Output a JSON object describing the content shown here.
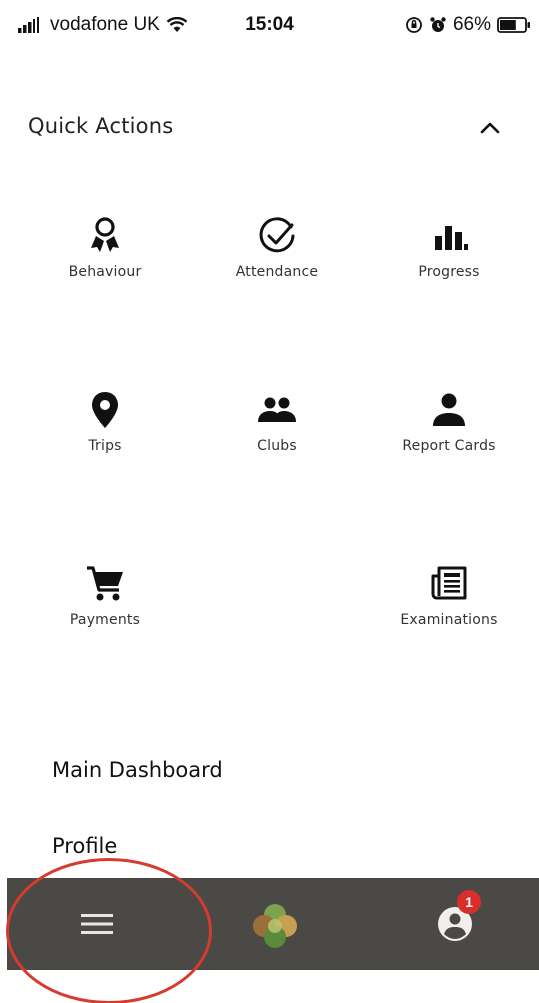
{
  "status_bar": {
    "carrier": "vodafone UK",
    "time": "15:04",
    "battery": "66%",
    "battery_level": 0.66
  },
  "quick_actions": {
    "title": "Quick Actions",
    "items": [
      {
        "label": "Behaviour",
        "icon": "award-ribbon-icon"
      },
      {
        "label": "Attendance",
        "icon": "check-circle-icon"
      },
      {
        "label": "Progress",
        "icon": "bar-chart-icon"
      },
      {
        "label": "Trips",
        "icon": "map-pin-icon"
      },
      {
        "label": "Clubs",
        "icon": "people-icon"
      },
      {
        "label": "Report Cards",
        "icon": "person-icon"
      },
      {
        "label": "Payments",
        "icon": "shopping-cart-icon"
      },
      {
        "label": "Examinations",
        "icon": "newspaper-icon"
      }
    ]
  },
  "menu": {
    "items": [
      {
        "label": "Main Dashboard"
      },
      {
        "label": "Profile"
      }
    ]
  },
  "bottom_nav": {
    "badge_count": "1",
    "colors": {
      "bar": "#4b4945",
      "badge": "#d92f2a",
      "highlight": "#d63b2f"
    }
  }
}
